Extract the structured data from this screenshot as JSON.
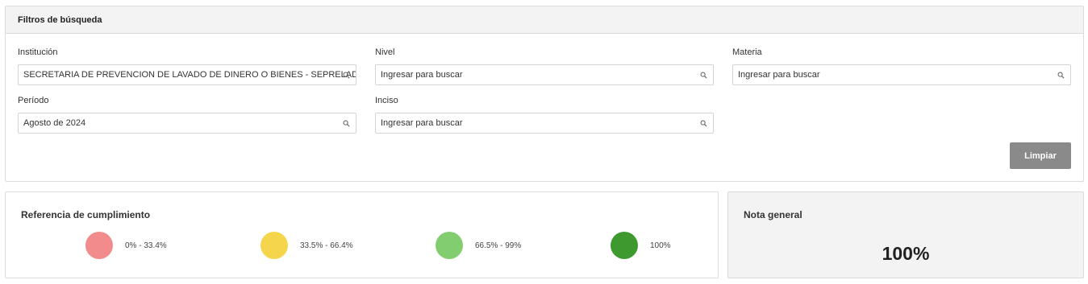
{
  "filters": {
    "title": "Filtros de búsqueda",
    "institucion": {
      "label": "Institución",
      "value": "SECRETARIA DE PREVENCION DE LAVADO DE DINERO O BIENES - SEPRELAD"
    },
    "nivel": {
      "label": "Nivel",
      "placeholder": "Ingresar para buscar"
    },
    "materia": {
      "label": "Materia",
      "placeholder": "Ingresar para buscar"
    },
    "periodo": {
      "label": "Período",
      "value": "Agosto de 2024"
    },
    "inciso": {
      "label": "Inciso",
      "placeholder": "Ingresar para buscar"
    },
    "clear_button": "Limpiar"
  },
  "reference": {
    "title": "Referencia de cumplimiento",
    "items": [
      {
        "label": "0% - 33.4%",
        "color": "#f28b8b"
      },
      {
        "label": "33.5% - 66.4%",
        "color": "#f5d54c"
      },
      {
        "label": "66.5% - 99%",
        "color": "#82cd6f"
      },
      {
        "label": "100%",
        "color": "#3e9a2f"
      }
    ]
  },
  "grade": {
    "title": "Nota general",
    "value": "100%"
  },
  "icons": {
    "search": "search-icon"
  }
}
